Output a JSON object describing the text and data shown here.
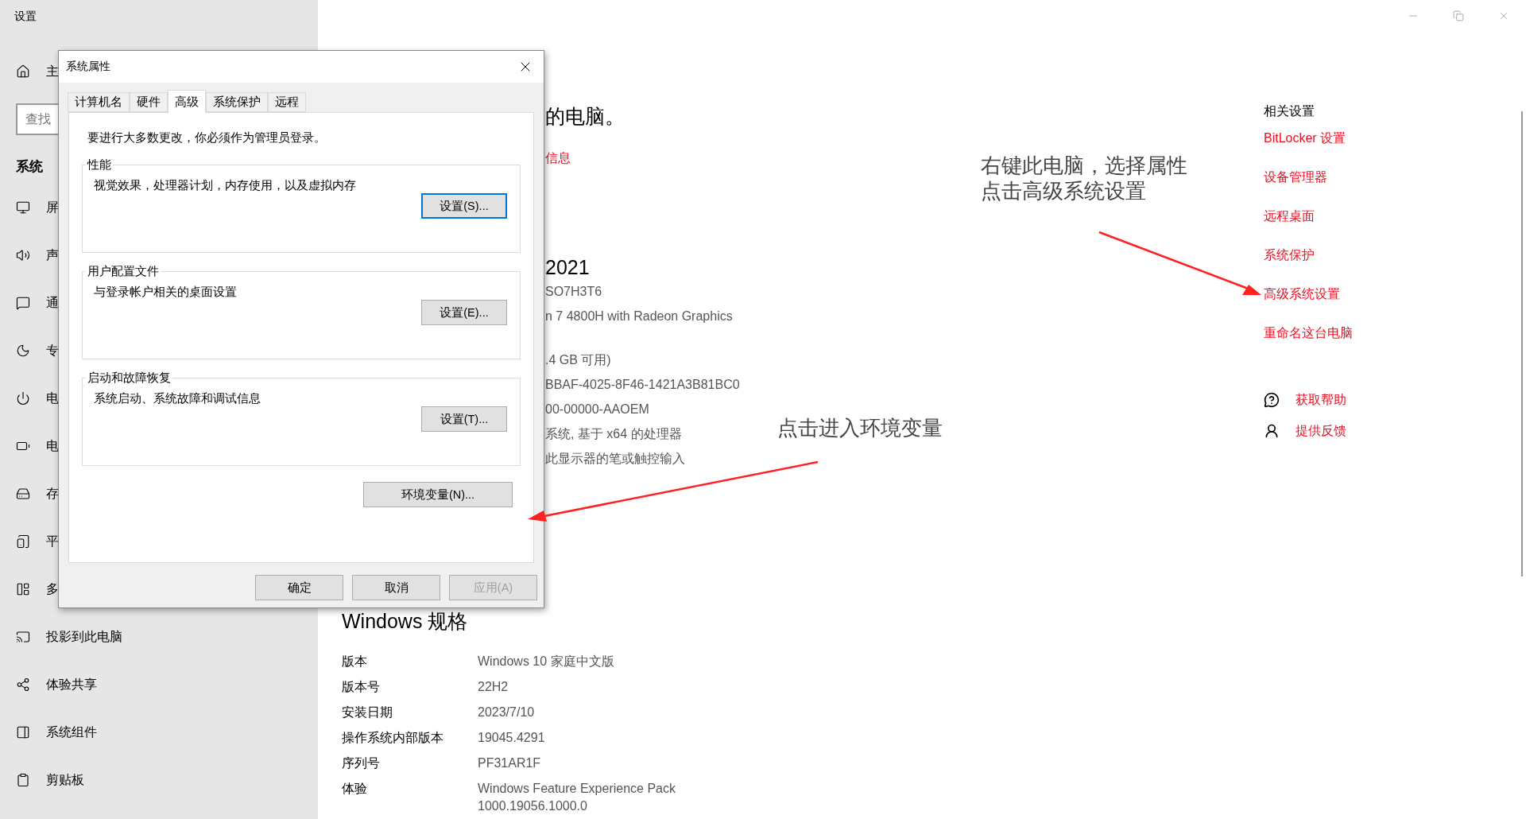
{
  "settings_window": {
    "title": "设置"
  },
  "sidebar": {
    "home": "主",
    "search": {
      "placeholder": "查找"
    },
    "section": "系统",
    "items": [
      {
        "label": "屏",
        "selected": false
      },
      {
        "label": "声",
        "selected": false
      },
      {
        "label": "通",
        "selected": false
      },
      {
        "label": "专",
        "selected": false
      },
      {
        "label": "电",
        "selected": false
      },
      {
        "label": "电",
        "selected": false
      },
      {
        "label": "存",
        "selected": false
      },
      {
        "label": "平",
        "selected": false
      },
      {
        "label": "多",
        "selected": false
      },
      {
        "label": "投影到此电脑",
        "selected": false
      },
      {
        "label": "体验共享",
        "selected": false
      },
      {
        "label": "系统组件",
        "selected": false
      },
      {
        "label": "剪贴板",
        "selected": false
      }
    ]
  },
  "about": {
    "heading": "的电脑。",
    "link": "信息",
    "device_name": "2021",
    "spec_groups": [
      [
        "SO7H3T6",
        "n 7 4800H with Radeon Graphics"
      ],
      [
        ".4 GB 可用)",
        "BBAF-4025-8F46-1421A3B81BC0",
        "00-00000-AAOEM",
        "系统, 基于 x64 的处理器",
        "此显示器的笔或触控输入"
      ]
    ]
  },
  "windows_spec": {
    "heading": "Windows 规格",
    "rows": [
      {
        "label": "版本",
        "value": "Windows 10 家庭中文版"
      },
      {
        "label": "版本号",
        "value": "22H2"
      },
      {
        "label": "安装日期",
        "value": "2023/7/10"
      },
      {
        "label": "操作系统内部版本",
        "value": "19045.4291"
      },
      {
        "label": "序列号",
        "value": "PF31AR1F"
      },
      {
        "label": "体验",
        "value": "Windows Feature Experience Pack 1000.19056.1000.0"
      }
    ]
  },
  "related": {
    "heading": "相关设置",
    "links": [
      "BitLocker 设置",
      "设备管理器",
      "远程桌面",
      "系统保护",
      "高级系统设置",
      "重命名这台电脑"
    ],
    "support": [
      {
        "kind": "help",
        "label": "获取帮助"
      },
      {
        "kind": "feedback",
        "label": "提供反馈"
      }
    ]
  },
  "annotations": [
    {
      "lines": [
        "右键此电脑，选择属性",
        "点击高级系统设置"
      ]
    },
    {
      "lines": [
        "点击进入环境变量"
      ]
    }
  ],
  "dialog": {
    "title": "系统属性",
    "tabs": [
      {
        "label": "计算机名",
        "selected": false
      },
      {
        "label": "硬件",
        "selected": false
      },
      {
        "label": "高级",
        "selected": true
      },
      {
        "label": "系统保护",
        "selected": false
      },
      {
        "label": "远程",
        "selected": false
      }
    ],
    "notice": "要进行大多数更改，你必须作为管理员登录。",
    "groups": [
      {
        "title": "性能",
        "description": "视觉效果，处理器计划，内存使用，以及虚拟内存",
        "button": "设置(S)...",
        "focused": true
      },
      {
        "title": "用户配置文件",
        "description": "与登录帐户相关的桌面设置",
        "button": "设置(E)...",
        "focused": false
      },
      {
        "title": "启动和故障恢复",
        "description": "系统启动、系统故障和调试信息",
        "button": "设置(T)...",
        "focused": false
      }
    ],
    "env_button": "环境变量(N)...",
    "buttons": [
      {
        "label": "确定",
        "disabled": false
      },
      {
        "label": "取消",
        "disabled": false
      },
      {
        "label": "应用(A)",
        "disabled": true
      }
    ]
  }
}
